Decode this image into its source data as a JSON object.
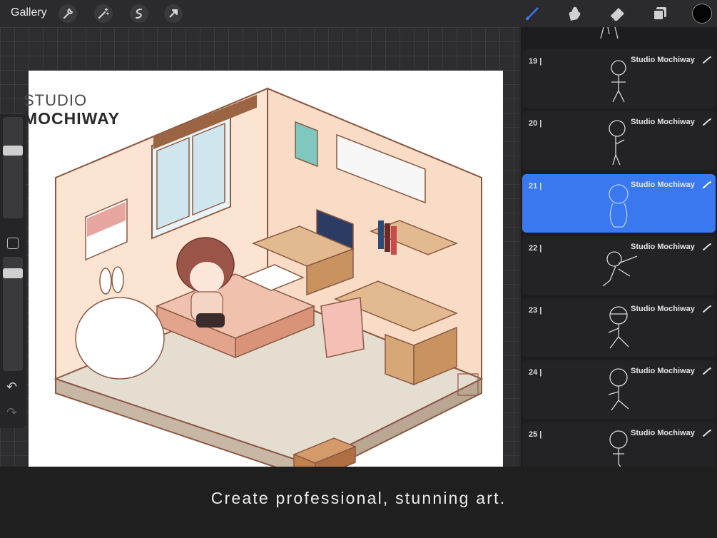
{
  "toolbar": {
    "gallery_label": "Gallery",
    "left_tools": [
      "wrench-icon",
      "magic-wand-icon",
      "selection-icon",
      "transform-arrow-icon"
    ],
    "right_tools": [
      "brush-icon",
      "smudge-icon",
      "eraser-icon",
      "layers-icon"
    ],
    "active_tool": "brush-icon",
    "current_color": "#050505",
    "accent_color": "#3a78f0"
  },
  "watermark": {
    "line1": "STUDIO",
    "line2": "MOCHIWAY"
  },
  "layers": [
    {
      "number": "19 |",
      "name": "Studio Mochiway",
      "active": false
    },
    {
      "number": "20 |",
      "name": "Studio Mochiway",
      "active": false
    },
    {
      "number": "21 |",
      "name": "Studio Mochiway",
      "active": true
    },
    {
      "number": "22 |",
      "name": "Studio Mochiway",
      "active": false
    },
    {
      "number": "23 |",
      "name": "Studio Mochiway",
      "active": false
    },
    {
      "number": "24 |",
      "name": "Studio Mochiway",
      "active": false
    },
    {
      "number": "25 |",
      "name": "Studio Mochiway",
      "active": false
    }
  ],
  "caption": "Create professional, stunning art."
}
